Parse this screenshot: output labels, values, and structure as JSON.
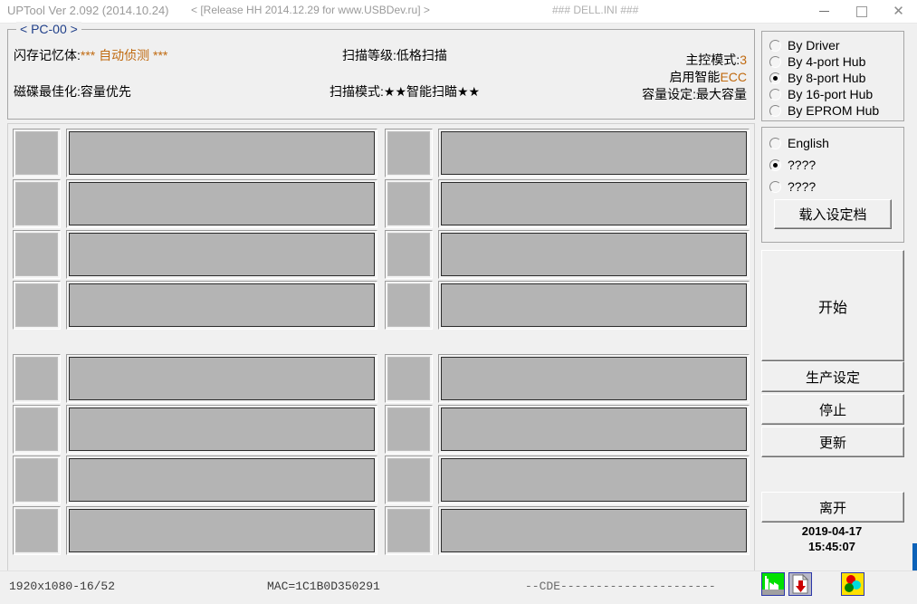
{
  "titlebar": {
    "app_title": "UPTool Ver 2.092 (2014.10.24)",
    "release_note": "< [Release HH 2014.12.29 for www.USBDev.ru] >",
    "ini_label": "### DELL.INI ###",
    "minimize_label": "Minimize",
    "maximize_label": "Maximize",
    "close_label": "Close"
  },
  "header": {
    "legend": "< PC-00 >",
    "left": [
      {
        "label": "闪存记忆体:",
        "value": "*** 自动侦测 ***",
        "accent": true
      },
      {
        "label": "磁碟最佳化:",
        "value": "容量优先",
        "accent": false
      }
    ],
    "middle": [
      {
        "label": "扫描等级:",
        "value": "低格扫描"
      },
      {
        "label": "扫描模式:",
        "value": "★★智能扫瞄★★"
      }
    ],
    "right": [
      {
        "label": "主控模式:",
        "value": "3",
        "accent": true
      },
      {
        "label": "启用智能",
        "value": "ECC",
        "accent": true
      },
      {
        "label": "容量设定:",
        "value": "最大容量",
        "accent": false
      }
    ]
  },
  "hub_panel": {
    "options": [
      {
        "label": "By Driver",
        "selected": false
      },
      {
        "label": "By 4-port Hub",
        "selected": false
      },
      {
        "label": "By 8-port Hub",
        "selected": true
      },
      {
        "label": "By 16-port Hub",
        "selected": false
      },
      {
        "label": "By EPROM Hub",
        "selected": false
      }
    ]
  },
  "language_panel": {
    "options": [
      {
        "label": "English",
        "selected": false
      },
      {
        "label": "????",
        "selected": true
      },
      {
        "label": "????",
        "selected": false
      }
    ],
    "load_config_label": "载入设定档"
  },
  "actions": {
    "start_label": "开始",
    "production_label": "生产设定",
    "stop_label": "停止",
    "update_label": "更新",
    "exit_label": "离开"
  },
  "clock": {
    "date": "2019-04-17",
    "time": "15:45:07"
  },
  "port_grid": {
    "groups": [
      {
        "rows": [
          {
            "cells": [
              {
                "badge": "",
                "bar": ""
              },
              {
                "badge": "",
                "bar": ""
              }
            ]
          },
          {
            "cells": [
              {
                "badge": "",
                "bar": ""
              },
              {
                "badge": "",
                "bar": ""
              }
            ]
          },
          {
            "cells": [
              {
                "badge": "",
                "bar": ""
              },
              {
                "badge": "",
                "bar": ""
              }
            ]
          },
          {
            "cells": [
              {
                "badge": "",
                "bar": ""
              },
              {
                "badge": "",
                "bar": ""
              }
            ]
          }
        ]
      },
      {
        "rows": [
          {
            "cells": [
              {
                "badge": "",
                "bar": ""
              },
              {
                "badge": "",
                "bar": ""
              }
            ]
          },
          {
            "cells": [
              {
                "badge": "",
                "bar": ""
              },
              {
                "badge": "",
                "bar": ""
              }
            ]
          },
          {
            "cells": [
              {
                "badge": "",
                "bar": ""
              },
              {
                "badge": "",
                "bar": ""
              }
            ]
          },
          {
            "cells": [
              {
                "badge": "",
                "bar": ""
              },
              {
                "badge": "",
                "bar": ""
              }
            ]
          }
        ]
      }
    ]
  },
  "statusbar": {
    "resolution": "1920x1080-16/52",
    "mac": "MAC=1C1B0D350291",
    "cde": "--CDE----------------------",
    "tray_icons": [
      "factory-icon",
      "download-document-icon",
      "color-wheel-icon"
    ]
  },
  "colors": {
    "accent_text": "#c06a10",
    "legend_text": "#21408a",
    "panel_bg": "#f0f0f0",
    "bar_fill": "#b4b4b4",
    "behind_window": "#0d62b8"
  }
}
